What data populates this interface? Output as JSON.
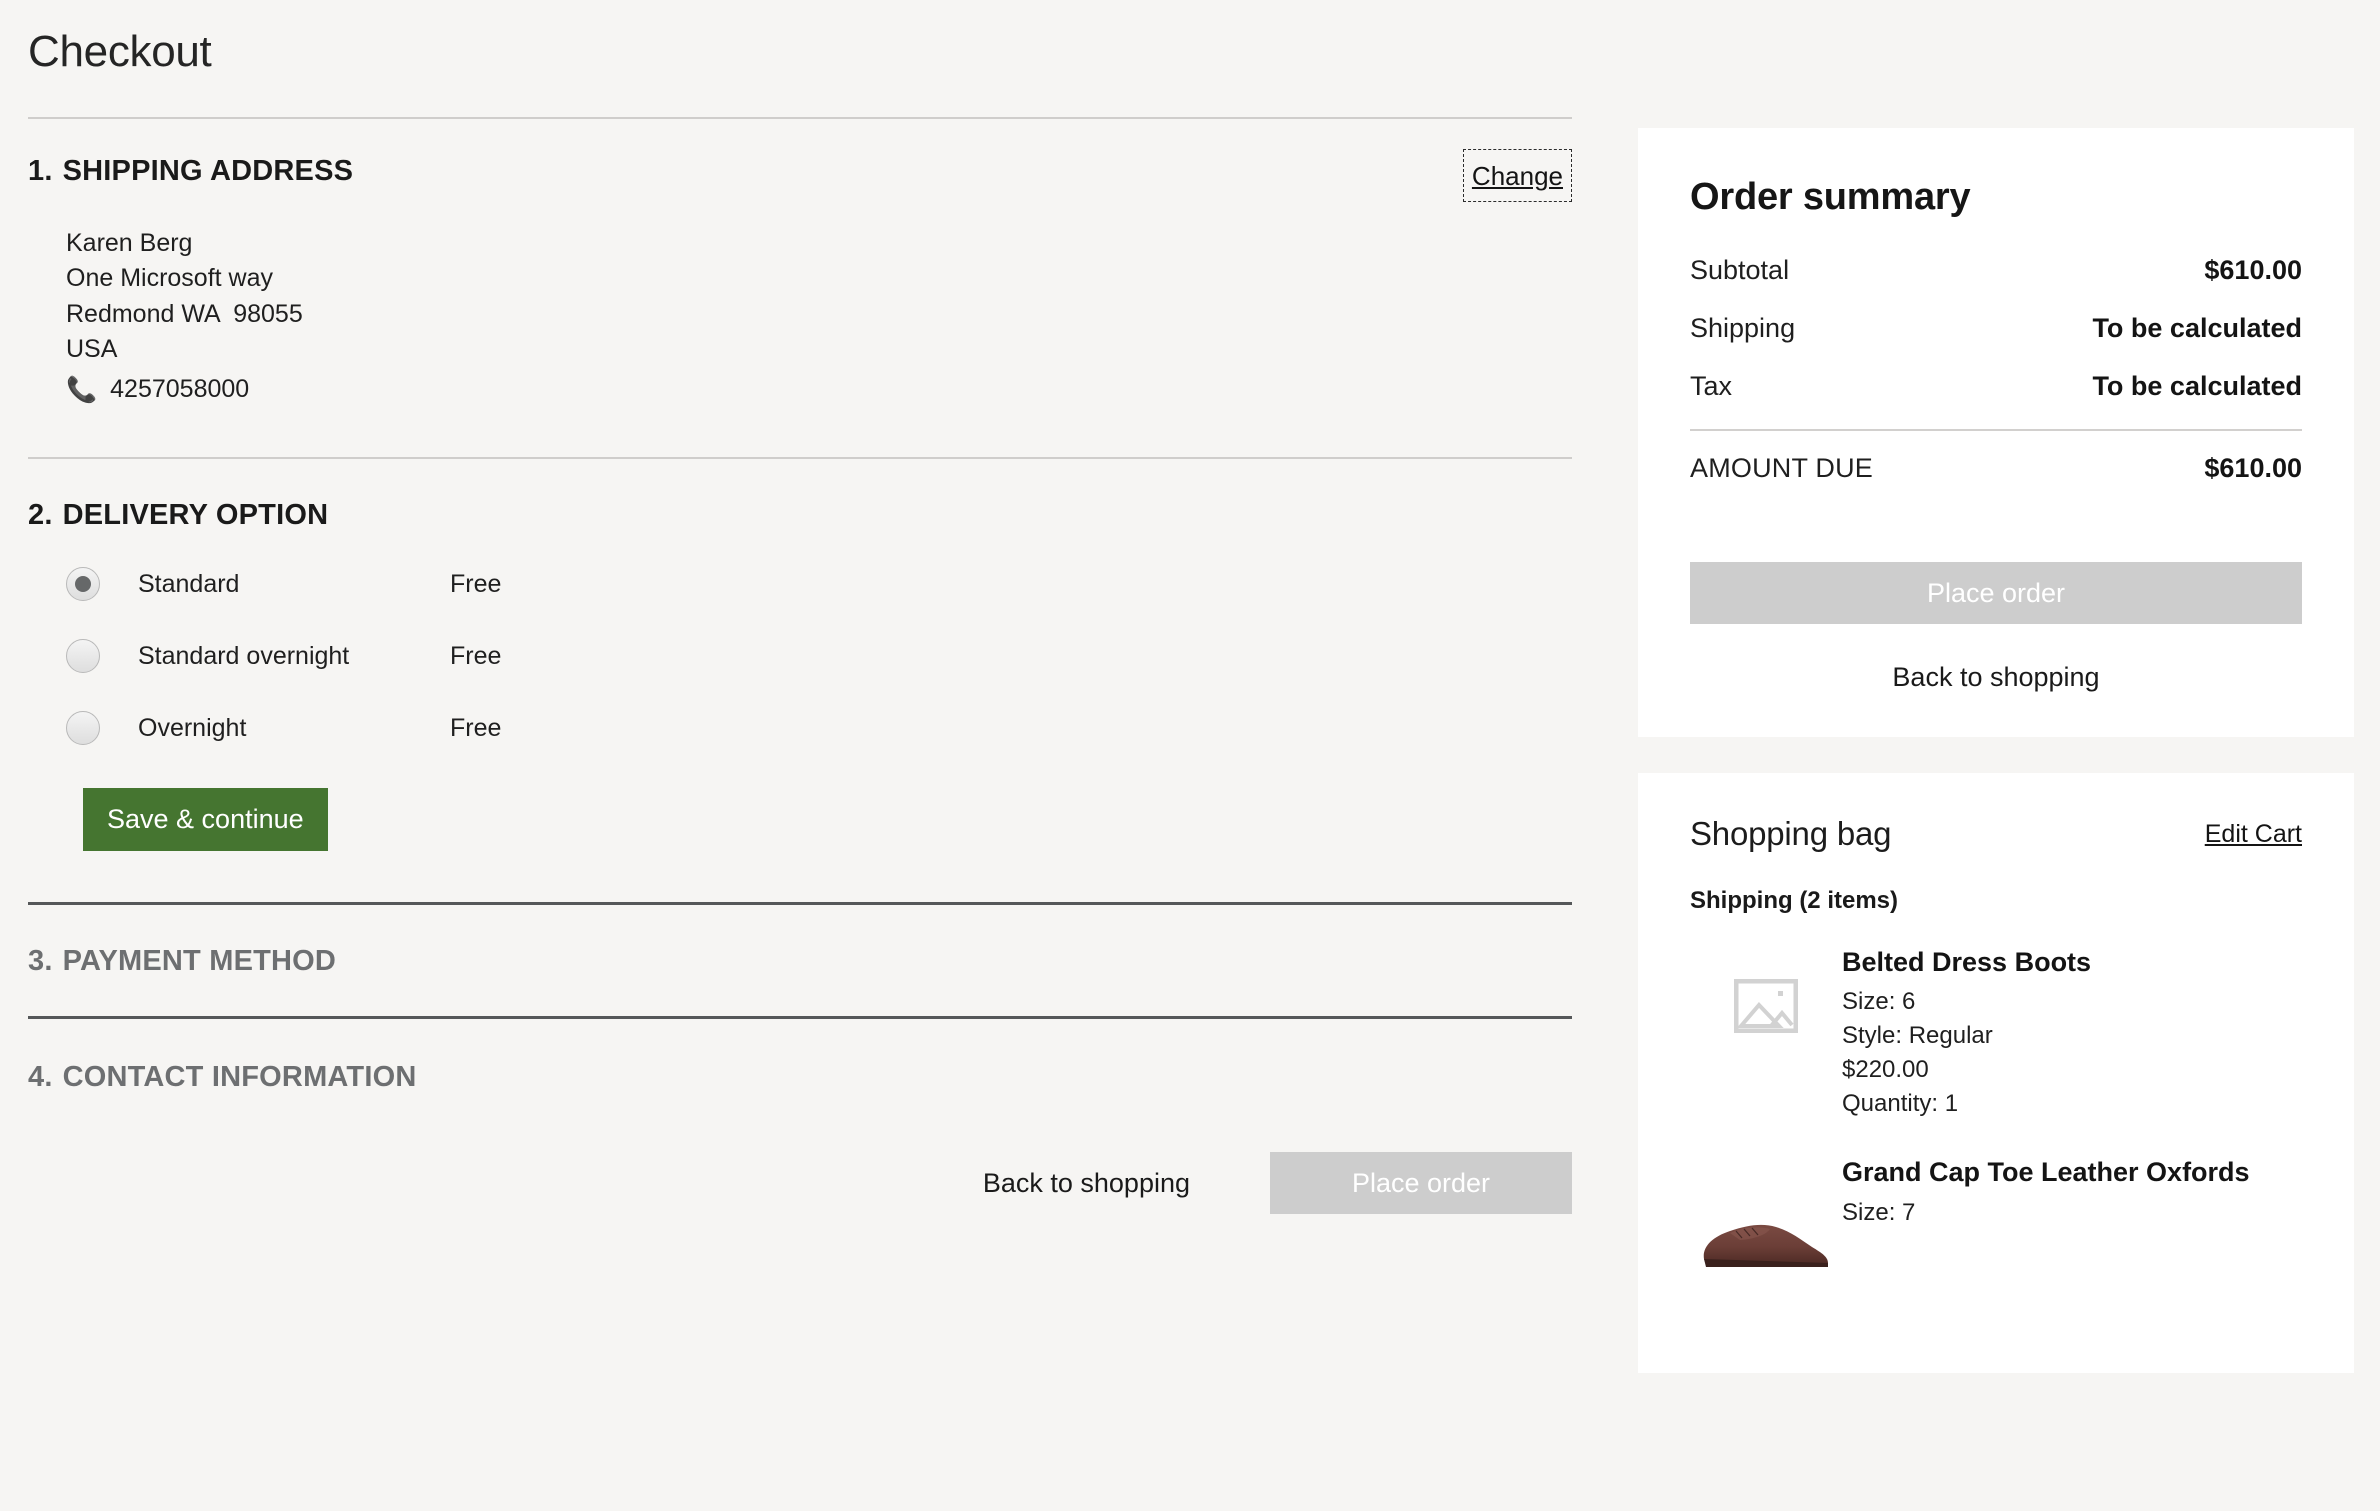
{
  "page": {
    "title": "Checkout"
  },
  "sections": {
    "shipping": {
      "number": "1.",
      "heading": "SHIPPING ADDRESS",
      "change_label": "Change",
      "address": {
        "name": "Karen Berg",
        "street": "One Microsoft way",
        "city_state_zip": "Redmond WA  98055",
        "country": "USA",
        "phone": "4257058000",
        "phone_icon": "phone-icon"
      }
    },
    "delivery": {
      "number": "2.",
      "heading": "DELIVERY OPTION",
      "options": [
        {
          "label": "Standard",
          "price": "Free",
          "selected": true
        },
        {
          "label": "Standard overnight",
          "price": "Free",
          "selected": false
        },
        {
          "label": "Overnight",
          "price": "Free",
          "selected": false
        }
      ],
      "save_label": "Save & continue"
    },
    "payment": {
      "number": "3.",
      "heading": "PAYMENT METHOD"
    },
    "contact": {
      "number": "4.",
      "heading": "CONTACT INFORMATION"
    }
  },
  "bottom_actions": {
    "back_label": "Back to shopping",
    "place_order_label": "Place order"
  },
  "order_summary": {
    "title": "Order summary",
    "rows": [
      {
        "label": "Subtotal",
        "value": "$610.00"
      },
      {
        "label": "Shipping",
        "value": "To be calculated"
      },
      {
        "label": "Tax",
        "value": "To be calculated"
      }
    ],
    "total": {
      "label": "AMOUNT DUE",
      "value": "$610.00"
    },
    "place_order_label": "Place order",
    "back_label": "Back to shopping"
  },
  "shopping_bag": {
    "title": "Shopping bag",
    "edit_label": "Edit Cart",
    "group_label": "Shipping (2 items)",
    "items": [
      {
        "name": "Belted Dress Boots",
        "size": "Size: 6",
        "style": "Style: Regular",
        "price": "$220.00",
        "quantity": "Quantity: 1",
        "thumb": "broken-image-placeholder-icon"
      },
      {
        "name": "Grand Cap Toe Leather Oxfords",
        "size": "Size: 7",
        "thumb": "product-photo-oxford-shoe"
      }
    ]
  },
  "colors": {
    "page_background": "#f6f5f3",
    "panel_background": "#ffffff",
    "primary_action": "#457530",
    "disabled_action": "#cdcdcd",
    "divider_light": "#cfcdcb",
    "divider_dark": "#555759",
    "muted_text": "#6d6f71"
  }
}
